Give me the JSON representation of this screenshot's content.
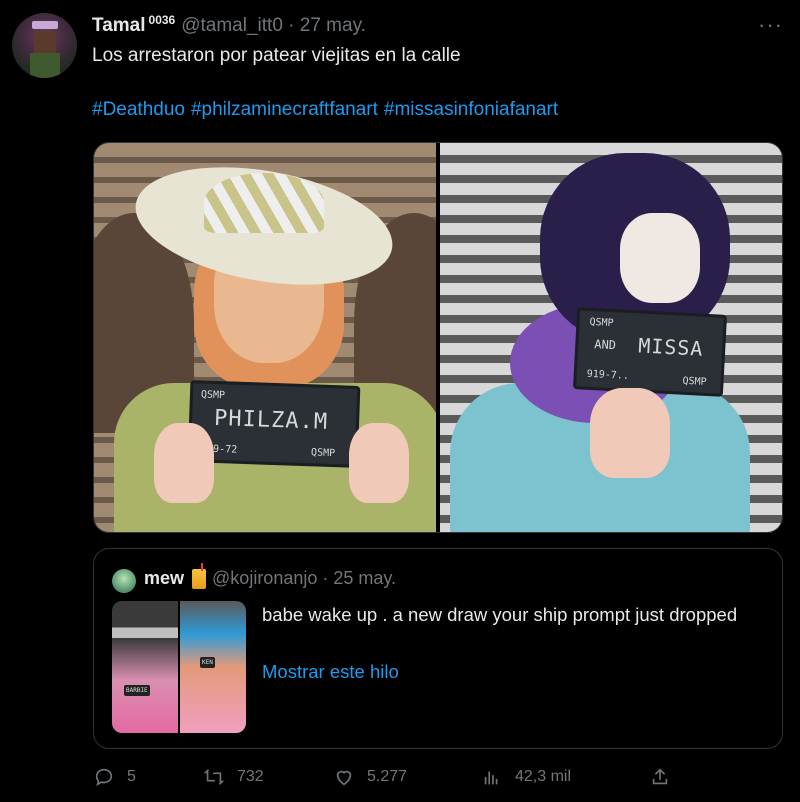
{
  "tweet": {
    "author_name": "Tamal",
    "author_sup": "0036",
    "handle_date": "@tamal_itt0 · 27 may.",
    "more": "···",
    "text": "Los arrestaron por patear viejitas en la calle",
    "hashtags": [
      "#Deathduo",
      "#philzaminecraftfanart",
      "#missasinfoniafanart"
    ]
  },
  "media": {
    "left_placard": {
      "line1": "QSMP",
      "name": "PHILZA.M",
      "num": "919-72",
      "tag": "QSMP"
    },
    "right_placard": {
      "line1": "QSMP",
      "line2": "AND",
      "name": "MISSA",
      "num": "919-7..",
      "tag": "QSMP"
    }
  },
  "quote": {
    "author_name": "mew",
    "handle_date": "@kojironanjo · 25 may.",
    "text": "babe wake up . a new draw your ship prompt just dropped",
    "link": "Mostrar este hilo",
    "thumb_a_label": "BARBIE",
    "thumb_b_label": "KEN"
  },
  "actions": {
    "replies": "5",
    "retweets": "732",
    "likes": "5.277",
    "views": "42,3 mil"
  },
  "colors": {
    "background": "#000000",
    "link": "#1d9bf0",
    "muted": "#71767b",
    "text": "#e7e9ea",
    "border": "#2f3336"
  },
  "icons": [
    "more-icon",
    "juice-emoji-icon",
    "reply-icon",
    "retweet-icon",
    "like-icon",
    "views-icon",
    "share-icon"
  ]
}
